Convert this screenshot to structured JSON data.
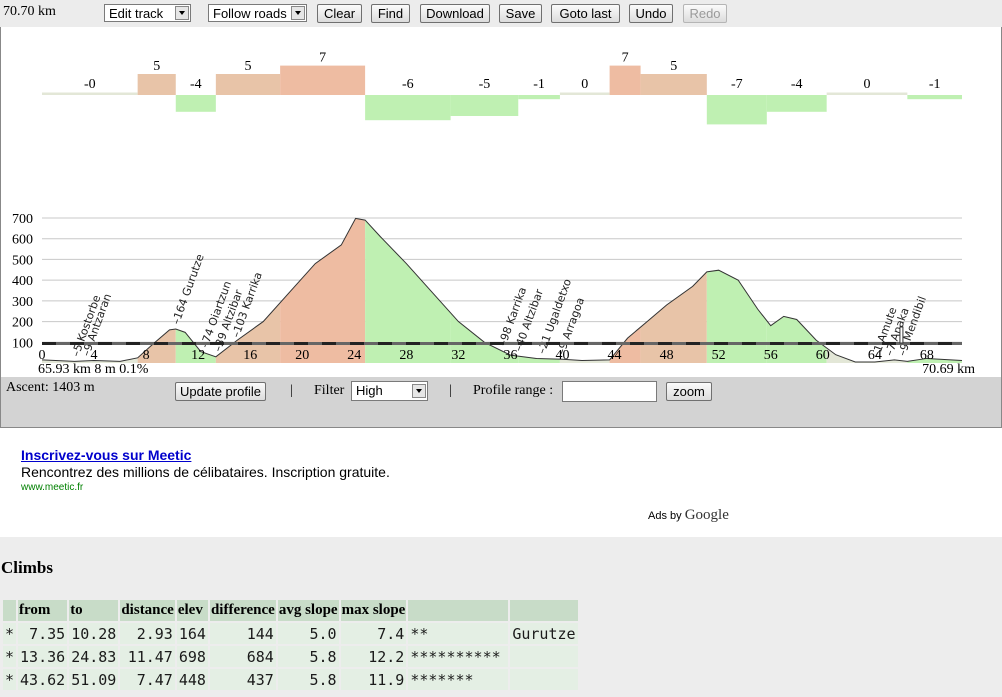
{
  "toolbar": {
    "total_distance": "70.70 km",
    "mode_select": "Edit track",
    "routing_select": "Follow roads",
    "buttons": [
      "Clear",
      "Find",
      "Download",
      "Save",
      "Goto last",
      "Undo",
      "Redo"
    ]
  },
  "grade_labels": [
    "-0",
    "5",
    "-4",
    "5",
    "7",
    "-6",
    "-5",
    "-1",
    "0",
    "7",
    "5",
    "-7",
    "-4",
    "0",
    "-1"
  ],
  "waypoints": [
    {
      "km": 2.5,
      "label": "5 Kostorbe"
    },
    {
      "km": 3.3,
      "label": "9 Antzaran"
    },
    {
      "km": 10.2,
      "label": "164 Gurutze"
    },
    {
      "km": 12.4,
      "label": "74 Oiartzun"
    },
    {
      "km": 13.4,
      "label": "39 Altzibar"
    },
    {
      "km": 14.8,
      "label": "103 Karrika"
    },
    {
      "km": 35.3,
      "label": "98 Karrika"
    },
    {
      "km": 36.5,
      "label": "40 Altzibar"
    },
    {
      "km": 38.3,
      "label": "21 Ugaldetxo"
    },
    {
      "km": 39.8,
      "label": "9 Arragoa"
    },
    {
      "km": 64.0,
      "label": "1 Amute"
    },
    {
      "km": 65.0,
      "label": "7 Anaka"
    },
    {
      "km": 66.0,
      "label": "9 Mendibil"
    }
  ],
  "chart_data": {
    "type": "area",
    "x_ticks": [
      0,
      4,
      8,
      12,
      16,
      20,
      24,
      28,
      32,
      36,
      40,
      44,
      48,
      52,
      56,
      60,
      64,
      68
    ],
    "y_ticks": [
      100,
      200,
      300,
      400,
      500,
      600,
      700
    ],
    "xlim": [
      0,
      70.7
    ],
    "ylim": [
      0,
      700
    ],
    "profile": {
      "x": [
        0,
        2.5,
        4,
        6,
        7.35,
        8.5,
        9.8,
        10.28,
        11,
        12.2,
        13.36,
        15,
        17,
        19,
        21,
        23,
        24.1,
        24.83,
        26,
        28,
        30,
        32,
        34,
        36,
        38,
        40,
        41.5,
        43.62,
        45,
        46.5,
        48,
        50,
        51.09,
        52,
        53.5,
        55,
        56,
        57,
        58,
        59.5,
        61,
        62.5,
        64,
        65.5,
        66.5,
        68,
        70.7
      ],
      "elevation": [
        15,
        8,
        12,
        8,
        25,
        90,
        160,
        164,
        148,
        55,
        30,
        110,
        200,
        340,
        480,
        570,
        698,
        690,
        610,
        480,
        340,
        200,
        100,
        38,
        22,
        18,
        12,
        15,
        120,
        200,
        280,
        370,
        440,
        448,
        400,
        260,
        180,
        225,
        210,
        110,
        40,
        5,
        5,
        15,
        8,
        22,
        12
      ]
    },
    "segments": [
      {
        "x0": 0,
        "x1": 7.35,
        "grade": 0
      },
      {
        "x0": 7.35,
        "x1": 10.28,
        "grade": 5
      },
      {
        "x0": 10.28,
        "x1": 13.36,
        "grade": -4
      },
      {
        "x0": 13.36,
        "x1": 18.3,
        "grade": 5
      },
      {
        "x0": 18.3,
        "x1": 24.83,
        "grade": 7
      },
      {
        "x0": 24.83,
        "x1": 31.4,
        "grade": -6
      },
      {
        "x0": 31.4,
        "x1": 36.6,
        "grade": -5
      },
      {
        "x0": 36.6,
        "x1": 39.8,
        "grade": -1
      },
      {
        "x0": 39.8,
        "x1": 43.62,
        "grade": 0
      },
      {
        "x0": 43.62,
        "x1": 46.0,
        "grade": 7
      },
      {
        "x0": 46.0,
        "x1": 51.09,
        "grade": 5
      },
      {
        "x0": 51.09,
        "x1": 55.7,
        "grade": -7
      },
      {
        "x0": 55.7,
        "x1": 60.3,
        "grade": -4
      },
      {
        "x0": 60.3,
        "x1": 66.5,
        "grade": 0
      },
      {
        "x0": 66.5,
        "x1": 70.7,
        "grade": -1
      }
    ],
    "colors": {
      "up": "#e8c4a8",
      "steep_up": "#eebca2",
      "down": "#bff0b2",
      "flat": "#e3e7d7",
      "line": "#333333",
      "grid": "#c8c8c8"
    },
    "selection_start_text": "65.93 km 8 m 0.1%",
    "selection_end_text": "70.69 km"
  },
  "profile_bar": {
    "ascent": "Ascent: 1403 m",
    "update_button": "Update profile",
    "separator": "|",
    "filter_label": "Filter",
    "filter_value": "High",
    "range_label": "Profile range :",
    "range_value": "",
    "zoom_button": "zoom"
  },
  "ad": {
    "title": "Inscrivez-vous sur Meetic",
    "text": "Rencontrez des millions de célibataires. Inscription gratuite.",
    "url": "www.meetic.fr",
    "ads_by": "Ads by",
    "google": "Google"
  },
  "climbs": {
    "title": "Climbs",
    "headers": [
      "",
      "from",
      "to",
      "distance",
      "elev",
      "difference",
      "avg slope",
      "max slope",
      "",
      ""
    ],
    "rows": [
      [
        "*",
        "7.35",
        "10.28",
        "2.93",
        "164",
        "144",
        "5.0",
        "7.4",
        "**",
        "Gurutze"
      ],
      [
        "*",
        "13.36",
        "24.83",
        "11.47",
        "698",
        "684",
        "5.8",
        "12.2",
        "**********",
        ""
      ],
      [
        "*",
        "43.62",
        "51.09",
        "7.47",
        "448",
        "437",
        "5.8",
        "11.9",
        "*******",
        ""
      ]
    ]
  }
}
